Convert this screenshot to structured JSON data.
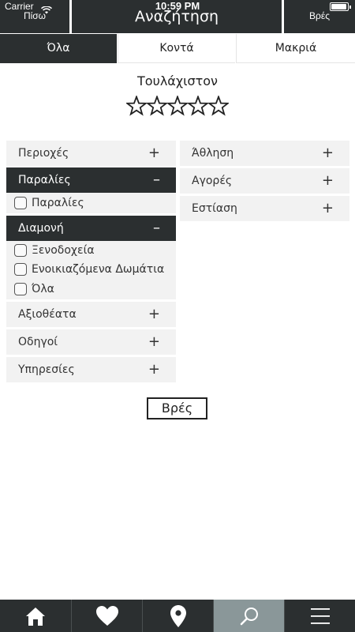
{
  "status_bar": {
    "carrier": "Carrier",
    "time": "10:59 PM"
  },
  "header": {
    "back_label": "Πίσω",
    "title": "Αναζήτηση",
    "find_label": "Βρές"
  },
  "distance_tabs": [
    {
      "label": "Όλα",
      "active": true
    },
    {
      "label": "Κοντά",
      "active": false
    },
    {
      "label": "Μακριά",
      "active": false
    }
  ],
  "rating": {
    "label": "Τουλάχιστον",
    "stars_total": 5,
    "stars_selected": 0
  },
  "categories_left": {
    "perioxes": {
      "label": "Περιοχές",
      "sign": "+"
    },
    "paralies": {
      "label": "Παραλίες",
      "sign": "–",
      "options": [
        "Παραλίες"
      ]
    },
    "diamoni": {
      "label": "Διαμονή",
      "sign": "–",
      "options": [
        "Ξενοδοχεία",
        "Ενοικιαζόμενα Δωμάτια",
        "Όλα"
      ]
    },
    "axiotheata": {
      "label": "Αξιοθέατα",
      "sign": "+"
    },
    "odigoi": {
      "label": "Οδηγοί",
      "sign": "+"
    },
    "ypiresies": {
      "label": "Υπηρεσίες",
      "sign": "+"
    }
  },
  "categories_right": {
    "athlisi": {
      "label": "Άθληση",
      "sign": "+"
    },
    "agores": {
      "label": "Αγορές",
      "sign": "+"
    },
    "estiasi": {
      "label": "Εστίαση",
      "sign": "+"
    }
  },
  "search_button": {
    "label": "Βρές"
  },
  "tab_bar": {
    "icons": [
      "home-icon",
      "heart-icon",
      "map-pin-icon",
      "search-icon",
      "menu-icon"
    ],
    "active_index": 3
  },
  "colors": {
    "dark": "#2b2f30",
    "panel": "#f2f2f2",
    "active_tab": "#8a9799"
  }
}
